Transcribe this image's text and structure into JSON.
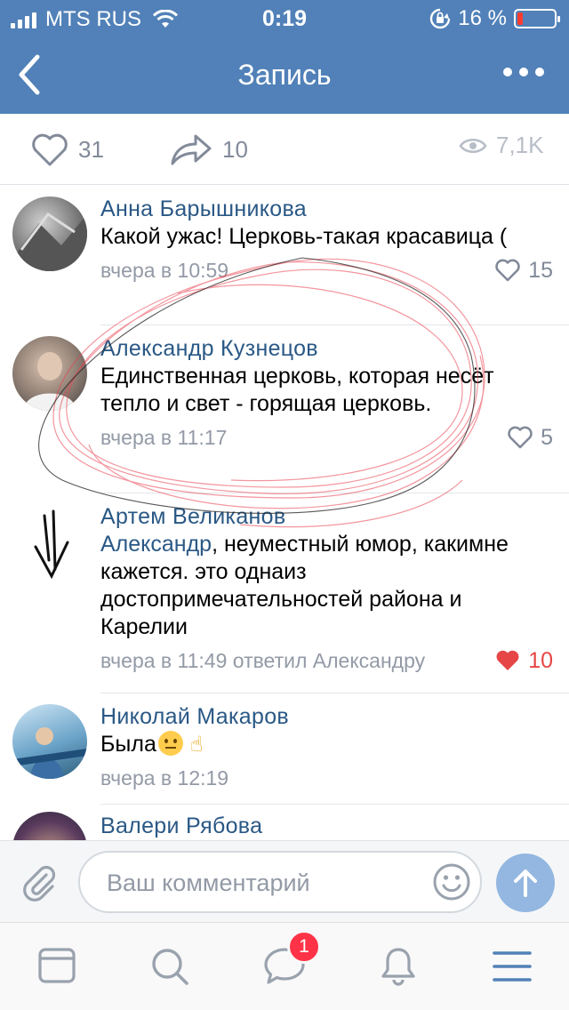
{
  "status_bar": {
    "carrier": "MTS RUS",
    "time": "0:19",
    "battery_percent": "16 %",
    "battery_level": 0.16
  },
  "nav": {
    "title": "Запись",
    "back_icon": "chevron-left-icon",
    "more_icon": "more-horizontal-icon"
  },
  "post_stats": {
    "likes": "31",
    "shares": "10",
    "views": "7,1K"
  },
  "comments": [
    {
      "author": "Анна Барышникова",
      "text": "Какой ужас! Церковь-такая красавица (",
      "time": "вчера в 10:59",
      "likes": "15",
      "liked": false
    },
    {
      "author": "Александр Кузнецов",
      "text": "Единственная церковь, которая несёт тепло и свет - горящая церковь.",
      "time": "вчера в 11:17",
      "likes": "5",
      "liked": false
    },
    {
      "author": "Артем Великанов",
      "mention": "Александр",
      "text": ", неуместный юмор, какимне кажется. это однаиз достопримечательностей района и Карелии",
      "time": "вчера в 11:49 ответил Александру",
      "likes": "10",
      "liked": true
    },
    {
      "author": "Николай Макаров",
      "text": "Была",
      "time": "вчера в 12:19",
      "likes": "",
      "liked": false
    },
    {
      "author": "Валери Рябова",
      "text": "",
      "time": "",
      "likes": "",
      "liked": false
    }
  ],
  "composer": {
    "placeholder": "Ваш комментарий"
  },
  "tabbar": {
    "messages_badge": "1"
  },
  "colors": {
    "brand": "#5181b8",
    "link": "#2a5885",
    "muted": "#939aa6",
    "liked": "#e64646",
    "badge": "#ff3347"
  }
}
